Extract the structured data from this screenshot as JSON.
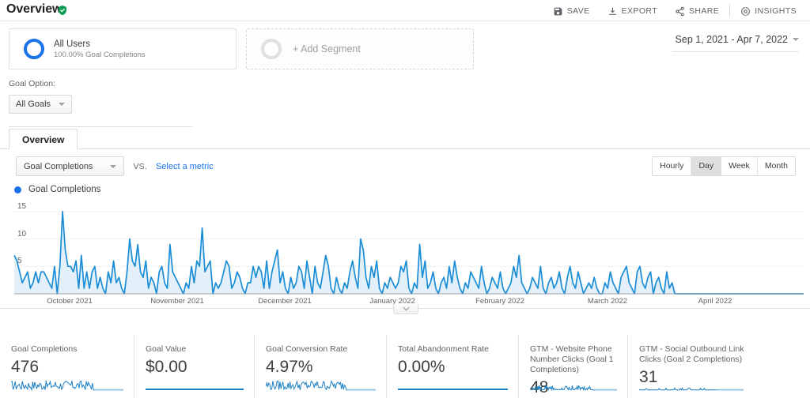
{
  "header": {
    "title": "Overview",
    "verified_icon": "verified-shield-icon",
    "toolbar": [
      {
        "label": "SAVE",
        "icon": "save-icon"
      },
      {
        "label": "EXPORT",
        "icon": "export-icon"
      },
      {
        "label": "SHARE",
        "icon": "share-icon"
      },
      {
        "label": "INSIGHTS",
        "icon": "insights-icon"
      }
    ]
  },
  "segments": {
    "all_users": {
      "name": "All Users",
      "subtitle": "100.00% Goal Completions"
    },
    "add_segment_label": "+ Add Segment"
  },
  "date_range": "Sep 1, 2021 - Apr 7, 2022",
  "goal_option": {
    "label": "Goal Option:",
    "selected": "All Goals"
  },
  "tabs": [
    {
      "label": "Overview",
      "active": true
    }
  ],
  "chart_controls": {
    "metric_selected": "Goal Completions",
    "vs_label": "VS.",
    "select_metric_link": "Select a metric",
    "granularity": [
      {
        "label": "Hourly",
        "active": false
      },
      {
        "label": "Day",
        "active": true
      },
      {
        "label": "Week",
        "active": false
      },
      {
        "label": "Month",
        "active": false
      }
    ]
  },
  "legend": {
    "label": "Goal Completions",
    "color": "#1a73e8"
  },
  "chart_data": {
    "type": "area",
    "title": "Goal Completions",
    "xlabel": "",
    "ylabel": "",
    "ylim": [
      0,
      17
    ],
    "yticks": [
      5,
      10,
      15
    ],
    "grid": true,
    "legend_position": "top-left",
    "line_color": "#1b8dd6",
    "fill_color": "#e3f0f9",
    "x_tick_labels": [
      "October 2021",
      "November 2021",
      "December 2021",
      "January 2022",
      "February 2022",
      "March 2022",
      "April 2022"
    ],
    "series": [
      {
        "name": "Goal Completions",
        "values": [
          7,
          6,
          4,
          2,
          3,
          4,
          1,
          2,
          4,
          2,
          4,
          4,
          3,
          2,
          1,
          5,
          0,
          5,
          15,
          8,
          5,
          5,
          4,
          6,
          1,
          7,
          1,
          4,
          1,
          4,
          5,
          1,
          3,
          1,
          0,
          4,
          2,
          6,
          2,
          3,
          1,
          0,
          4,
          10,
          6,
          5,
          9,
          4,
          3,
          6,
          1,
          3,
          2,
          0,
          4,
          5,
          2,
          1,
          9,
          4,
          3,
          2,
          1,
          0,
          2,
          1,
          5,
          2,
          6,
          5,
          12,
          4,
          5,
          6,
          0,
          2,
          1,
          2,
          4,
          6,
          5,
          1,
          2,
          4,
          3,
          1,
          0,
          2,
          2,
          5,
          3,
          5,
          4,
          1,
          6,
          1,
          4,
          6,
          8,
          2,
          4,
          1,
          0,
          3,
          1,
          2,
          5,
          4,
          1,
          6,
          3,
          0,
          5,
          2,
          1,
          4,
          7,
          5,
          1,
          0,
          3,
          1,
          0,
          2,
          1,
          4,
          6,
          3,
          1,
          10,
          8,
          3,
          1,
          5,
          3,
          6,
          1,
          0,
          2,
          1,
          3,
          2,
          1,
          2,
          5,
          4,
          6,
          1,
          0,
          2,
          1,
          9,
          3,
          6,
          1,
          2,
          4,
          1,
          0,
          2,
          3,
          1,
          5,
          2,
          6,
          3,
          1,
          0,
          2,
          1,
          4,
          3,
          2,
          1,
          5,
          2,
          0,
          1,
          3,
          2,
          1,
          4,
          1,
          0,
          1,
          2,
          5,
          3,
          7,
          2,
          1,
          0,
          1,
          3,
          2,
          1,
          5,
          1,
          0,
          2,
          3,
          1,
          2,
          4,
          1,
          0,
          3,
          5,
          2,
          1,
          4,
          2,
          0,
          1,
          2,
          1,
          3,
          1,
          0,
          0,
          2,
          1,
          4,
          2,
          1,
          0,
          3,
          4,
          5,
          2,
          1,
          0,
          4,
          5,
          2,
          1,
          3,
          4,
          0,
          2,
          3,
          1,
          0,
          4,
          1,
          2,
          0,
          0,
          0,
          0,
          0,
          0,
          0,
          0,
          0,
          0,
          0,
          0,
          0,
          0,
          0,
          0,
          0,
          0,
          0,
          0,
          0,
          0,
          0,
          0,
          0,
          0,
          0,
          0,
          0,
          0,
          0,
          0,
          0,
          0,
          0,
          0,
          0,
          0,
          0,
          0,
          0,
          0,
          0,
          0,
          0,
          0,
          0,
          0,
          0
        ]
      }
    ]
  },
  "metric_cards": [
    {
      "title": "Goal Completions",
      "value": "476",
      "sparkline": "dense",
      "name": "goal-completions"
    },
    {
      "title": "Goal Value",
      "value": "$0.00",
      "sparkline": "flat",
      "name": "goal-value"
    },
    {
      "title": "Goal Conversion Rate",
      "value": "4.97%",
      "sparkline": "dense",
      "name": "goal-conversion-rate"
    },
    {
      "title": "Total Abandonment Rate",
      "value": "0.00%",
      "sparkline": "flat",
      "name": "total-abandonment-rate"
    },
    {
      "title": "GTM - Website Phone Number Clicks (Goal 1 Completions)",
      "value": "48",
      "sparkline": "sparse",
      "name": "gtm-website-phone-number-clicks"
    },
    {
      "title": "GTM - Social Outbound Link Clicks (Goal 2 Completions)",
      "value": "31",
      "sparkline": "sparser",
      "name": "gtm-social-outbound-link-clicks"
    }
  ]
}
